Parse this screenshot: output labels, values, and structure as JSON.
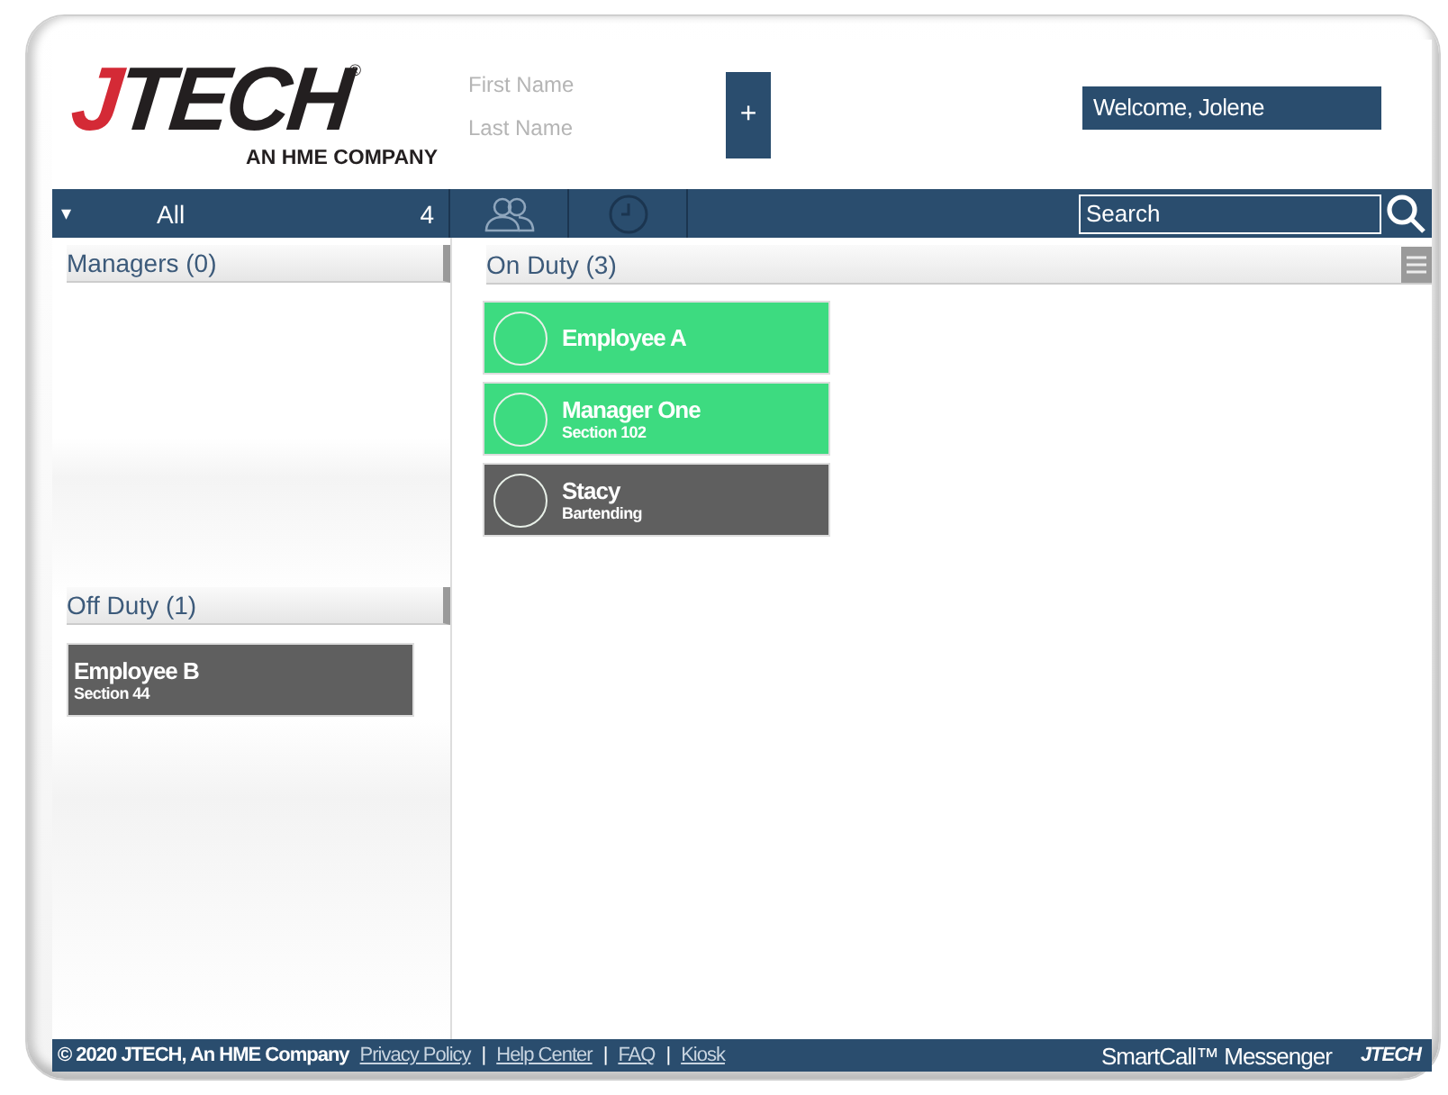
{
  "logo": {
    "name": "JTECH",
    "mark": "®",
    "tagline": "AN HME COMPANY"
  },
  "name_fields": [
    {
      "placeholder": "First Name"
    },
    {
      "placeholder": "Last Name"
    }
  ],
  "add_button": "+",
  "welcome": "Welcome, Jolene",
  "nav": {
    "caret": "▾",
    "filter": "All",
    "count": "4",
    "search": {
      "placeholder": "Search"
    }
  },
  "groups": [
    {
      "title": "Managers (0)"
    },
    {
      "title": "Off Duty (1)",
      "employees": [
        {
          "name": "Employee B",
          "detail": "Section 44",
          "color": "#5f5f5f"
        }
      ]
    }
  ],
  "on_duty": {
    "title": "On Duty (3)",
    "employees": [
      {
        "name": "Employee A",
        "color": "#3ddb80"
      },
      {
        "name": "Manager One",
        "detail": "Section 102",
        "color": "#3ddb80"
      },
      {
        "name": "Stacy",
        "detail": "Bartending",
        "color": "#5f5f5f"
      }
    ]
  },
  "footer": {
    "copyright": "© 2020 JTECH, An HME Company",
    "links": [
      "Privacy Policy",
      "Help Center",
      "FAQ",
      "Kiosk"
    ],
    "separator": "|",
    "product": "SmartCall™ Messenger",
    "brand": "JTECH"
  }
}
